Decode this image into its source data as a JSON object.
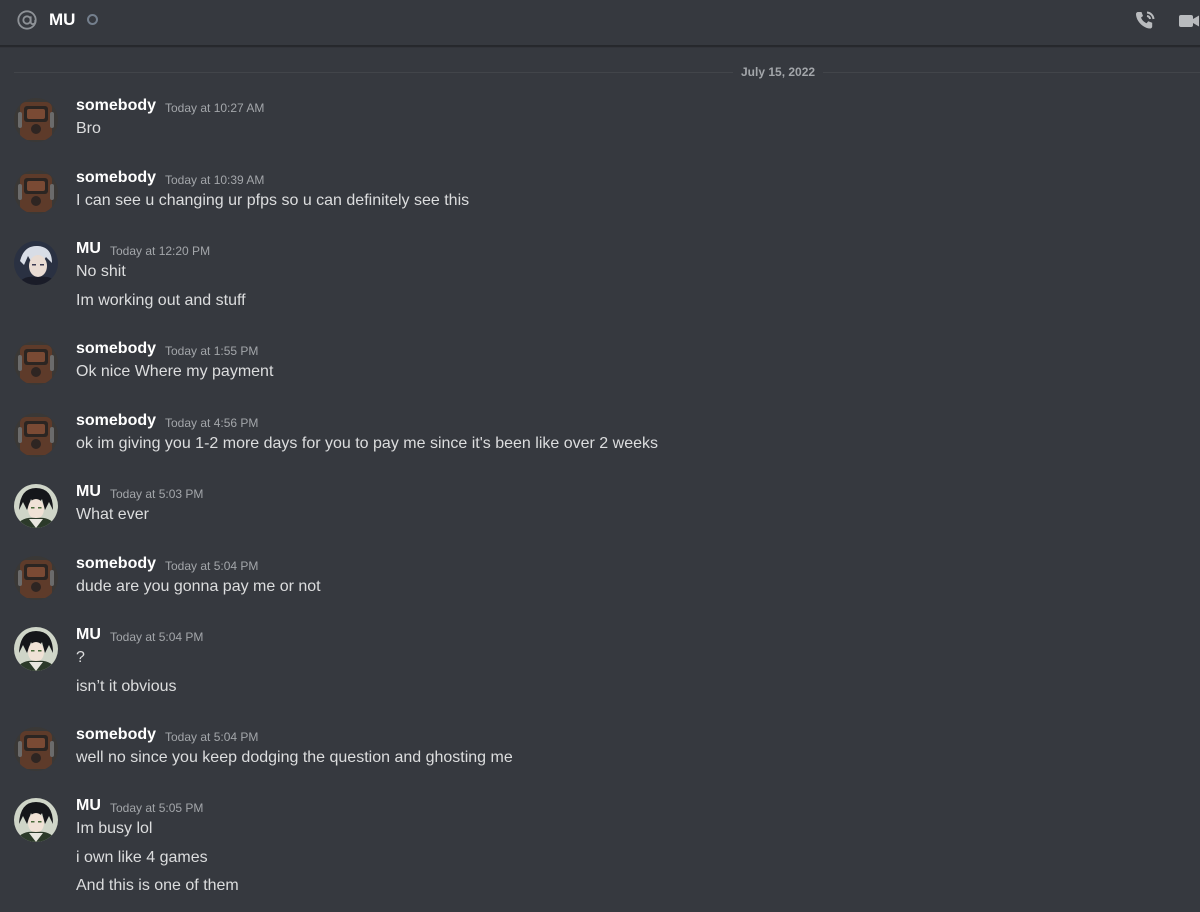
{
  "header": {
    "title": "MU",
    "status": "offline",
    "icons": {
      "at": "at-icon",
      "call": "phone-call-icon",
      "video": "video-camera-icon"
    }
  },
  "divider": {
    "date": "July 15, 2022"
  },
  "colors": {
    "background": "#36393f",
    "author": "#ffffff",
    "text": "#dcddde",
    "timestamp": "#a3a6aa",
    "status_offline": "#747f8d"
  },
  "messages": [
    {
      "author": "somebody",
      "avatar": "brown-device-avatar",
      "timestamp": "Today at 10:27 AM",
      "lines": [
        "Bro"
      ]
    },
    {
      "author": "somebody",
      "avatar": "brown-device-avatar",
      "timestamp": "Today at 10:39 AM",
      "lines": [
        "I can see u changing ur pfps so u can definitely see this"
      ]
    },
    {
      "author": "MU",
      "avatar": "silver-hair-anime-avatar",
      "timestamp": "Today at 12:20 PM",
      "lines": [
        "No shit",
        "Im working out and stuff"
      ]
    },
    {
      "author": "somebody",
      "avatar": "brown-device-avatar",
      "timestamp": "Today at 1:55 PM",
      "lines": [
        "Ok nice Where my payment"
      ]
    },
    {
      "author": "somebody",
      "avatar": "brown-device-avatar",
      "timestamp": "Today at 4:56 PM",
      "lines": [
        "ok im giving you 1-2 more days for you to pay me since it's been like over 2 weeks"
      ]
    },
    {
      "author": "MU",
      "avatar": "dark-hair-anime-avatar",
      "timestamp": "Today at 5:03 PM",
      "lines": [
        "What ever"
      ]
    },
    {
      "author": "somebody",
      "avatar": "brown-device-avatar",
      "timestamp": "Today at 5:04 PM",
      "lines": [
        "dude are you gonna pay me or not"
      ]
    },
    {
      "author": "MU",
      "avatar": "dark-hair-anime-avatar",
      "timestamp": "Today at 5:04 PM",
      "lines": [
        "?",
        "isn’t it obvious"
      ]
    },
    {
      "author": "somebody",
      "avatar": "brown-device-avatar",
      "timestamp": "Today at 5:04 PM",
      "lines": [
        "well no since you keep dodging the question and ghosting me"
      ]
    },
    {
      "author": "MU",
      "avatar": "dark-hair-anime-avatar",
      "timestamp": "Today at 5:05 PM",
      "lines": [
        "Im busy lol",
        "i own like 4 games",
        "And this is one of them"
      ]
    }
  ]
}
